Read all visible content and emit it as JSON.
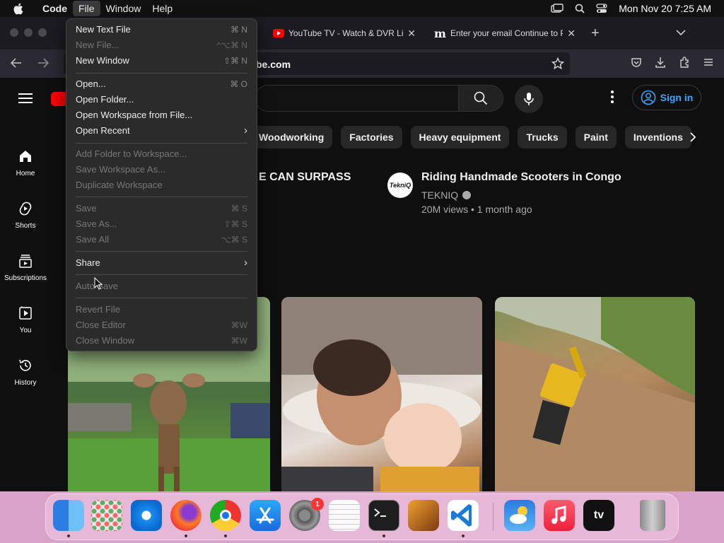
{
  "menubar": {
    "app_name": "Code",
    "items": [
      "File",
      "Window",
      "Help"
    ],
    "clock": "Mon Nov 20  7:25 AM"
  },
  "browser": {
    "tabs": [
      {
        "title": "YouTube TV - Watch & DVR Live",
        "icon": "youtube-icon"
      },
      {
        "title": "Enter your email Continue to Po",
        "icon": "m-logo-icon"
      }
    ],
    "url": "be.com"
  },
  "youtube": {
    "signin_label": "Sign in",
    "sidebar": [
      {
        "label": "Home",
        "icon": "home-icon"
      },
      {
        "label": "Shorts",
        "icon": "shorts-icon"
      },
      {
        "label": "Subscriptions",
        "icon": "subscriptions-icon"
      },
      {
        "label": "You",
        "icon": "you-icon"
      },
      {
        "label": "History",
        "icon": "history-icon"
      }
    ],
    "chips": [
      "Woodworking",
      "Factories",
      "Heavy equipment",
      "Trucks",
      "Paint",
      "Inventions"
    ],
    "partial_video_title": "E CAN SURPASS",
    "video": {
      "title": "Riding Handmade Scooters in Congo",
      "channel": "TEKNIQ",
      "channel_avatar_text": "TekniQ",
      "meta": "20M views • 1 month ago"
    }
  },
  "file_menu": {
    "items": [
      {
        "label": "New Text File",
        "shortcut": "⌘ N",
        "disabled": false
      },
      {
        "label": "New File...",
        "shortcut": "^⌥⌘ N",
        "disabled": true
      },
      {
        "label": "New Window",
        "shortcut": "⇧⌘ N",
        "disabled": false
      },
      {
        "label": "Open...",
        "shortcut": "⌘ O",
        "disabled": false
      },
      {
        "label": "Open Folder...",
        "shortcut": "",
        "disabled": false
      },
      {
        "label": "Open Workspace from File...",
        "shortcut": "",
        "disabled": false
      },
      {
        "label": "Open Recent",
        "shortcut": "",
        "submenu": true,
        "disabled": false
      },
      {
        "label": "Add Folder to Workspace...",
        "shortcut": "",
        "disabled": true
      },
      {
        "label": "Save Workspace As...",
        "shortcut": "",
        "disabled": true
      },
      {
        "label": "Duplicate Workspace",
        "shortcut": "",
        "disabled": true
      },
      {
        "label": "Save",
        "shortcut": "⌘ S",
        "disabled": true
      },
      {
        "label": "Save As...",
        "shortcut": "⇧⌘ S",
        "disabled": true
      },
      {
        "label": "Save All",
        "shortcut": "⌥⌘ S",
        "disabled": true
      },
      {
        "label": "Share",
        "shortcut": "",
        "submenu": true,
        "disabled": false
      },
      {
        "label": "Auto Save",
        "shortcut": "",
        "disabled": true
      },
      {
        "label": "Revert File",
        "shortcut": "",
        "disabled": true
      },
      {
        "label": "Close Editor",
        "shortcut": "⌘W",
        "disabled": true
      },
      {
        "label": "Close Window",
        "shortcut": "⌘W",
        "disabled": true
      }
    ]
  },
  "dock": {
    "apps": [
      "finder",
      "launchpad",
      "safari",
      "firefox",
      "chrome",
      "app-store",
      "system-settings",
      "textedit",
      "terminal",
      "garageband",
      "vscode",
      "weather",
      "music",
      "apple-tv",
      "trash"
    ],
    "settings_badge": "1",
    "tv_label": "tv"
  },
  "colors": {
    "signin_blue": "#3ea6ff",
    "youtube_red": "#ff0000",
    "badge_red": "#ff3b30"
  }
}
